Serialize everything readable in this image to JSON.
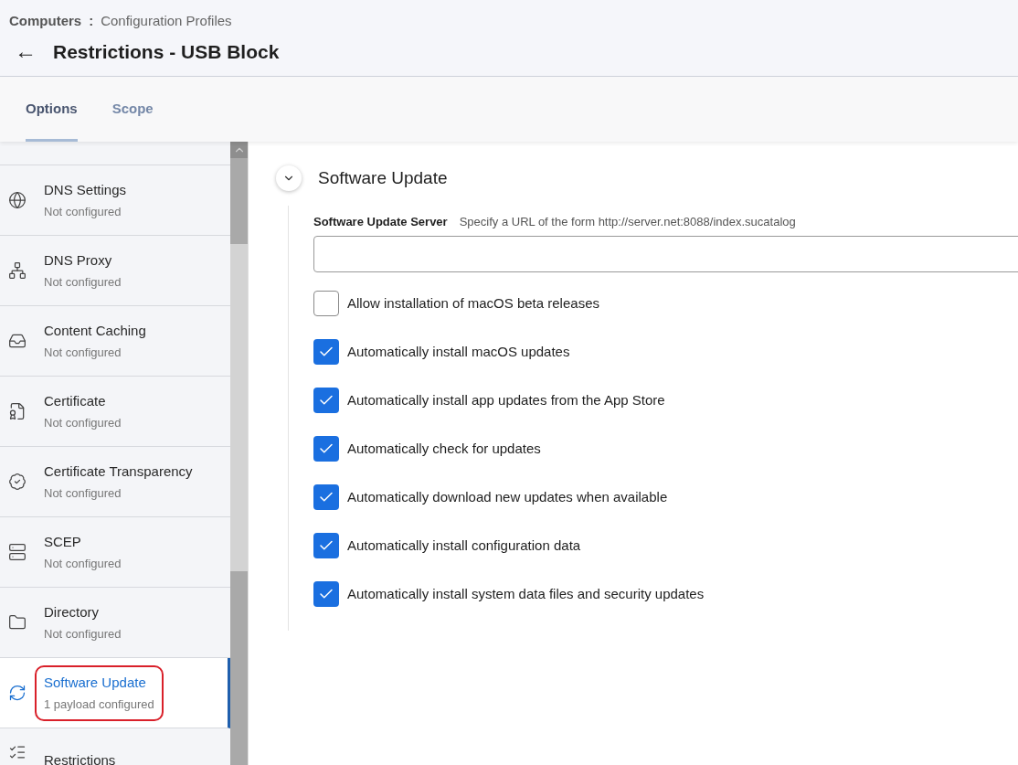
{
  "breadcrumb": {
    "root": "Computers",
    "separator": ":",
    "current": "Configuration Profiles"
  },
  "title": "Restrictions - USB Block",
  "back_button": "←",
  "tabs": [
    {
      "label": "Options",
      "selected": true
    },
    {
      "label": "Scope",
      "selected": false
    }
  ],
  "sidebar": {
    "items": [
      {
        "label": "DNS Settings",
        "status": "Not configured",
        "selected": false
      },
      {
        "label": "DNS Proxy",
        "status": "Not configured",
        "selected": false
      },
      {
        "label": "Content Caching",
        "status": "Not configured",
        "selected": false
      },
      {
        "label": "Certificate",
        "status": "Not configured",
        "selected": false
      },
      {
        "label": "Certificate Transparency",
        "status": "Not configured",
        "selected": false
      },
      {
        "label": "SCEP",
        "status": "Not configured",
        "selected": false
      },
      {
        "label": "Directory",
        "status": "Not configured",
        "selected": false
      },
      {
        "label": "Software Update",
        "status": "1 payload configured",
        "selected": true,
        "highlighted": true
      },
      {
        "label": "Restrictions",
        "selected": false
      }
    ]
  },
  "section": {
    "title": "Software Update",
    "expanded": true,
    "server_field": {
      "label": "Software Update Server",
      "hint": "Specify a URL of the form http://server.net:8088/index.sucatalog"
    },
    "options": [
      {
        "label": "Allow installation of macOS beta releases",
        "checked": false
      },
      {
        "label": "Automatically install macOS updates",
        "checked": true
      },
      {
        "label": "Automatically install app updates from the App Store",
        "checked": true
      },
      {
        "label": "Automatically check for updates",
        "checked": true
      },
      {
        "label": "Automatically download new updates when available",
        "checked": true
      },
      {
        "label": "Automatically install configuration data",
        "checked": true
      },
      {
        "label": "Automatically install system data files and security updates",
        "checked": true
      }
    ]
  }
}
